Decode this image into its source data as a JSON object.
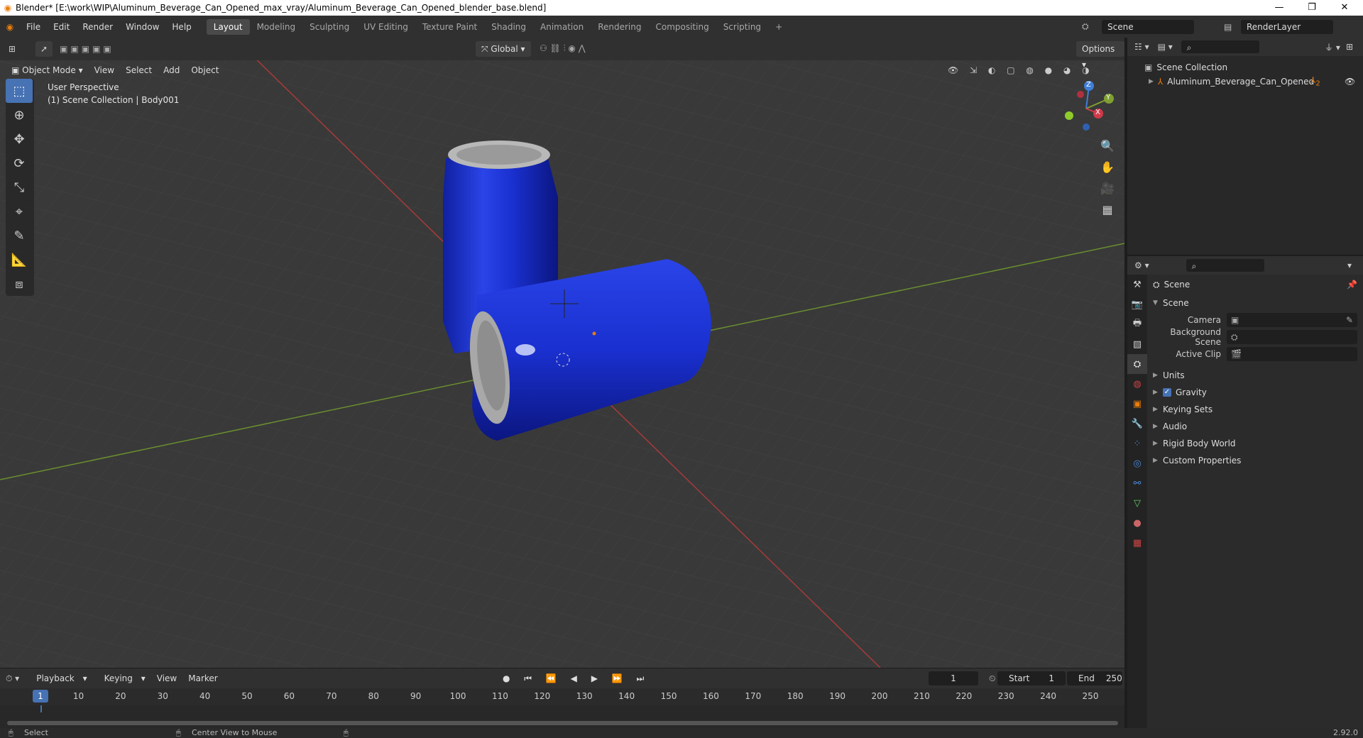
{
  "titlebar": {
    "title": "Blender* [E:\\work\\WIP\\Aluminum_Beverage_Can_Opened_max_vray/Aluminum_Beverage_Can_Opened_blender_base.blend]",
    "minimize": "—",
    "maximize": "❐",
    "close": "✕"
  },
  "menubar": {
    "items": [
      "File",
      "Edit",
      "Render",
      "Window",
      "Help"
    ],
    "workspaces": [
      "Layout",
      "Modeling",
      "Sculpting",
      "UV Editing",
      "Texture Paint",
      "Shading",
      "Animation",
      "Rendering",
      "Compositing",
      "Scripting"
    ],
    "active_workspace": "Layout",
    "add_workspace": "+",
    "scene_name": "Scene",
    "render_layer": "RenderLayer"
  },
  "viewport": {
    "mode": "Object Mode",
    "menus": [
      "View",
      "Select",
      "Add",
      "Object"
    ],
    "orientation": "Global",
    "options": "Options",
    "perspective_label": "User Perspective",
    "collection_label": "(1) Scene Collection | Body001",
    "axes": {
      "x": "X",
      "y": "Y",
      "z": "Z"
    },
    "can_color": "#1a2fd0"
  },
  "timeline": {
    "menus": [
      "Playback",
      "Keying",
      "View",
      "Marker"
    ],
    "current_frame": "1",
    "start_label": "Start",
    "start": "1",
    "end_label": "End",
    "end": "250",
    "ticks": [
      "10",
      "20",
      "30",
      "40",
      "50",
      "60",
      "70",
      "80",
      "90",
      "100",
      "110",
      "120",
      "130",
      "140",
      "150",
      "160",
      "170",
      "180",
      "190",
      "200",
      "210",
      "220",
      "230",
      "240",
      "250"
    ],
    "cursor_label": "1"
  },
  "statusbar": {
    "left": "Select",
    "middle": "Center View to Mouse",
    "version": "2.92.0"
  },
  "outliner": {
    "root": "Scene Collection",
    "item": "Aluminum_Beverage_Can_Opened",
    "item_count": "2"
  },
  "properties": {
    "header": "Scene",
    "section": "Scene",
    "fields": [
      {
        "label": "Camera"
      },
      {
        "label": "Background Scene"
      },
      {
        "label": "Active Clip"
      }
    ],
    "panels": [
      "Units",
      "Gravity",
      "Keying Sets",
      "Audio",
      "Rigid Body World",
      "Custom Properties"
    ],
    "gravity_checked": true
  }
}
